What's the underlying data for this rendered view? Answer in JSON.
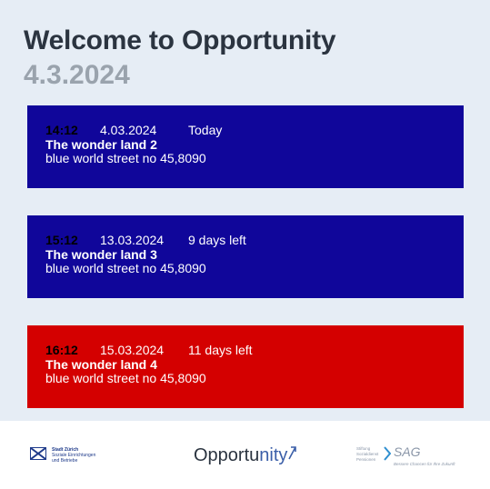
{
  "header": {
    "title": "Welcome to Opportunity",
    "date": "4.3.2024"
  },
  "events": [
    {
      "time": "14:12",
      "date": "4.03.2024",
      "relative": "Today",
      "name": "The wonder land 2",
      "address": "blue world street no 45,8090",
      "color": "#10069a"
    },
    {
      "time": "15:12",
      "date": "13.03.2024",
      "relative": "9 days left",
      "name": "The wonder land 3",
      "address": "blue world street no 45,8090",
      "color": "#10069a"
    },
    {
      "time": "16:12",
      "date": "15.03.2024",
      "relative": "11 days left",
      "name": "The wonder land 4",
      "address": "blue world street no 45,8090",
      "color": "#d40000"
    }
  ],
  "footer": {
    "logo_left_line1": "Stadt Zürich",
    "logo_left_line2": "Soziale Einrichtungen",
    "logo_left_line3": "und Betriebe",
    "logo_center_main": "Opportu",
    "logo_center_accent": "nity",
    "logo_right_small1": "Stiftung",
    "logo_right_small2": "Sozialdienst",
    "logo_right_small3": "Pensionen",
    "logo_right_brand": "SAG",
    "logo_right_sub": "Bessere Chancen für Ihre Zukunft"
  },
  "colors": {
    "background_top": "#e6edf5",
    "card_blue": "#10069a",
    "card_red": "#d40000",
    "title": "#2b3440",
    "date": "#9aa3ad"
  }
}
